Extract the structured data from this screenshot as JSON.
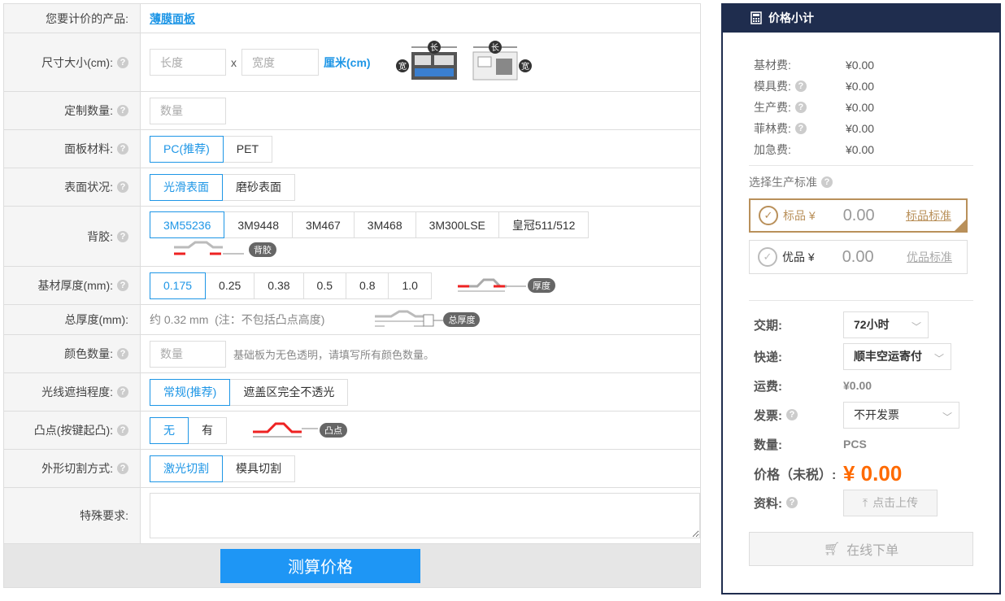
{
  "form": {
    "product": {
      "label": "您要计价的产品:",
      "value": "薄膜面板"
    },
    "size": {
      "label": "尺寸大小(cm):",
      "length_placeholder": "长度",
      "width_placeholder": "宽度",
      "sep": "x",
      "unit": "厘米(cm)",
      "diagram_long": "长",
      "diagram_wide": "宽"
    },
    "quantity": {
      "label": "定制数量:",
      "placeholder": "数量"
    },
    "material": {
      "label": "面板材料:",
      "options": [
        "PC(推荐)",
        "PET"
      ],
      "selected": 0
    },
    "surface": {
      "label": "表面状况:",
      "options": [
        "光滑表面",
        "磨砂表面"
      ],
      "selected": 0
    },
    "adhesive": {
      "label": "背胶:",
      "options": [
        "3M55236",
        "3M9448",
        "3M467",
        "3M468",
        "3M300LSE",
        "皇冠511/512"
      ],
      "selected": 0,
      "tag": "背胶"
    },
    "thickness": {
      "label": "基材厚度(mm):",
      "options": [
        "0.175",
        "0.25",
        "0.38",
        "0.5",
        "0.8",
        "1.0"
      ],
      "selected": 0,
      "tag": "厚度"
    },
    "total_thickness": {
      "label": "总厚度(mm):",
      "value": "约 0.32 mm  (注：不包括凸点高度)",
      "tag": "总厚度"
    },
    "colors": {
      "label": "颜色数量:",
      "placeholder": "数量",
      "note": "基础板为无色透明，请填写所有颜色数量。"
    },
    "shading": {
      "label": "光线遮挡程度:",
      "options": [
        "常规(推荐)",
        "遮盖区完全不透光"
      ],
      "selected": 0
    },
    "bump": {
      "label": "凸点(按键起凸):",
      "options": [
        "无",
        "有"
      ],
      "selected": 0,
      "tag": "凸点"
    },
    "cutting": {
      "label": "外形切割方式:",
      "options": [
        "激光切割",
        "模具切割"
      ],
      "selected": 0
    },
    "special": {
      "label": "特殊要求:",
      "value": ""
    },
    "calc_button": "测算价格"
  },
  "summary": {
    "title": "价格小计",
    "fees": [
      {
        "label": "基材费:",
        "value": "¥0.00",
        "help": false
      },
      {
        "label": "模具费:",
        "value": "¥0.00",
        "help": true
      },
      {
        "label": "生产费:",
        "value": "¥0.00",
        "help": true
      },
      {
        "label": "菲林费:",
        "value": "¥0.00",
        "help": true
      },
      {
        "label": "加急费:",
        "value": "¥0.00",
        "help": false
      }
    ],
    "standard_title": "选择生产标准",
    "standards": [
      {
        "name": "标品 ¥",
        "price": "0.00",
        "link": "标品标准"
      },
      {
        "name": "优品 ¥",
        "price": "0.00",
        "link": "优品标准"
      }
    ],
    "delivery": {
      "label": "交期:",
      "value": "72小时"
    },
    "express": {
      "label": "快递:",
      "value": "顺丰空运寄付"
    },
    "shipping": {
      "label": "运费:",
      "value": "¥0.00"
    },
    "invoice": {
      "label": "发票:",
      "value": "不开发票"
    },
    "qty": {
      "label": "数量:",
      "value": "PCS"
    },
    "price": {
      "label": "价格（未税）:",
      "value": "¥ 0.00"
    },
    "docs": {
      "label": "资料:",
      "upload": "点击上传"
    },
    "order_button": "在线下单",
    "colors": {
      "accent": "#1e96e6",
      "header": "#1f2d4e",
      "price": "#ff6a00",
      "gold": "#b9905a"
    }
  }
}
